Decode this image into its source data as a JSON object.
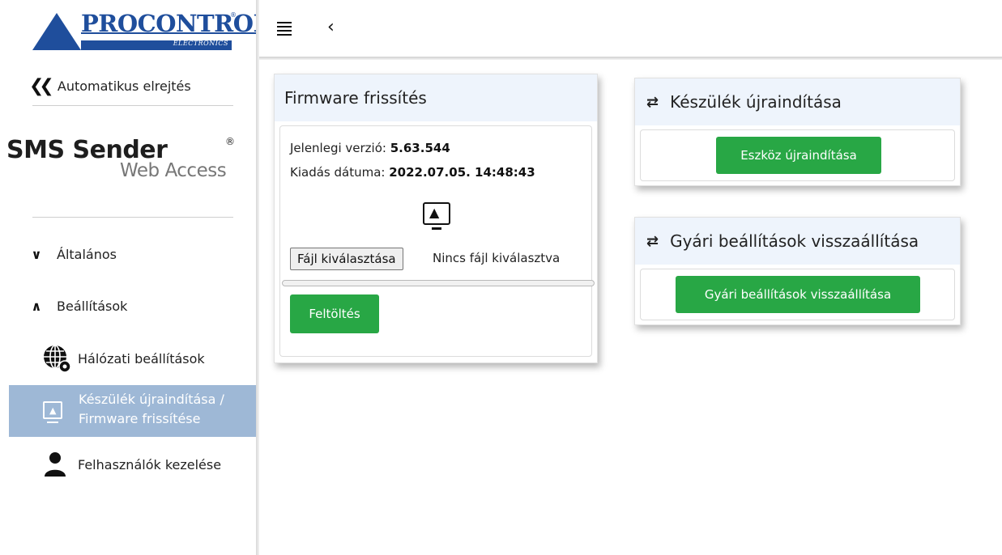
{
  "sidebar": {
    "logo": {
      "name": "PROCONTROL",
      "sub": "ELECTRONICS",
      "reg": "®"
    },
    "autohide_label": "Automatikus elrejtés",
    "brand": {
      "main": "SMS Sender",
      "reg": "®",
      "sub": "Web Access"
    },
    "groups": [
      {
        "label": "Általános",
        "expanded": false
      },
      {
        "label": "Beállítások",
        "expanded": true
      }
    ],
    "items": [
      {
        "label": "Hálózati beállítások",
        "icon": "globe-gear-icon"
      },
      {
        "label_line1": "Készülék újraindítása /",
        "label_line2": "Firmware frissítése",
        "icon": "upload-screen-icon",
        "active": true
      },
      {
        "label": "Felhasználók kezelése",
        "icon": "user-icon"
      }
    ]
  },
  "firmware": {
    "title": "Firmware frissítés",
    "version_label": "Jelenlegi verzió:",
    "version_value": "5.63.544",
    "date_label": "Kiadás dátuma:",
    "date_value": "2022.07.05. 14:48:43",
    "file_button": "Fájl kiválasztása",
    "file_none": "Nincs fájl kiválasztva",
    "progress": 0,
    "upload_button": "Feltöltés"
  },
  "restart": {
    "title": "Készülék újraindítása",
    "button": "Eszköz újraindítása"
  },
  "factory": {
    "title": "Gyári beállítások visszaállítása",
    "button": "Gyári beállítások visszaállítása"
  },
  "colors": {
    "brand_blue": "#1f4e9c",
    "active_nav": "#9eb8d6",
    "success": "#28a745",
    "card_header": "#eef4fc"
  }
}
